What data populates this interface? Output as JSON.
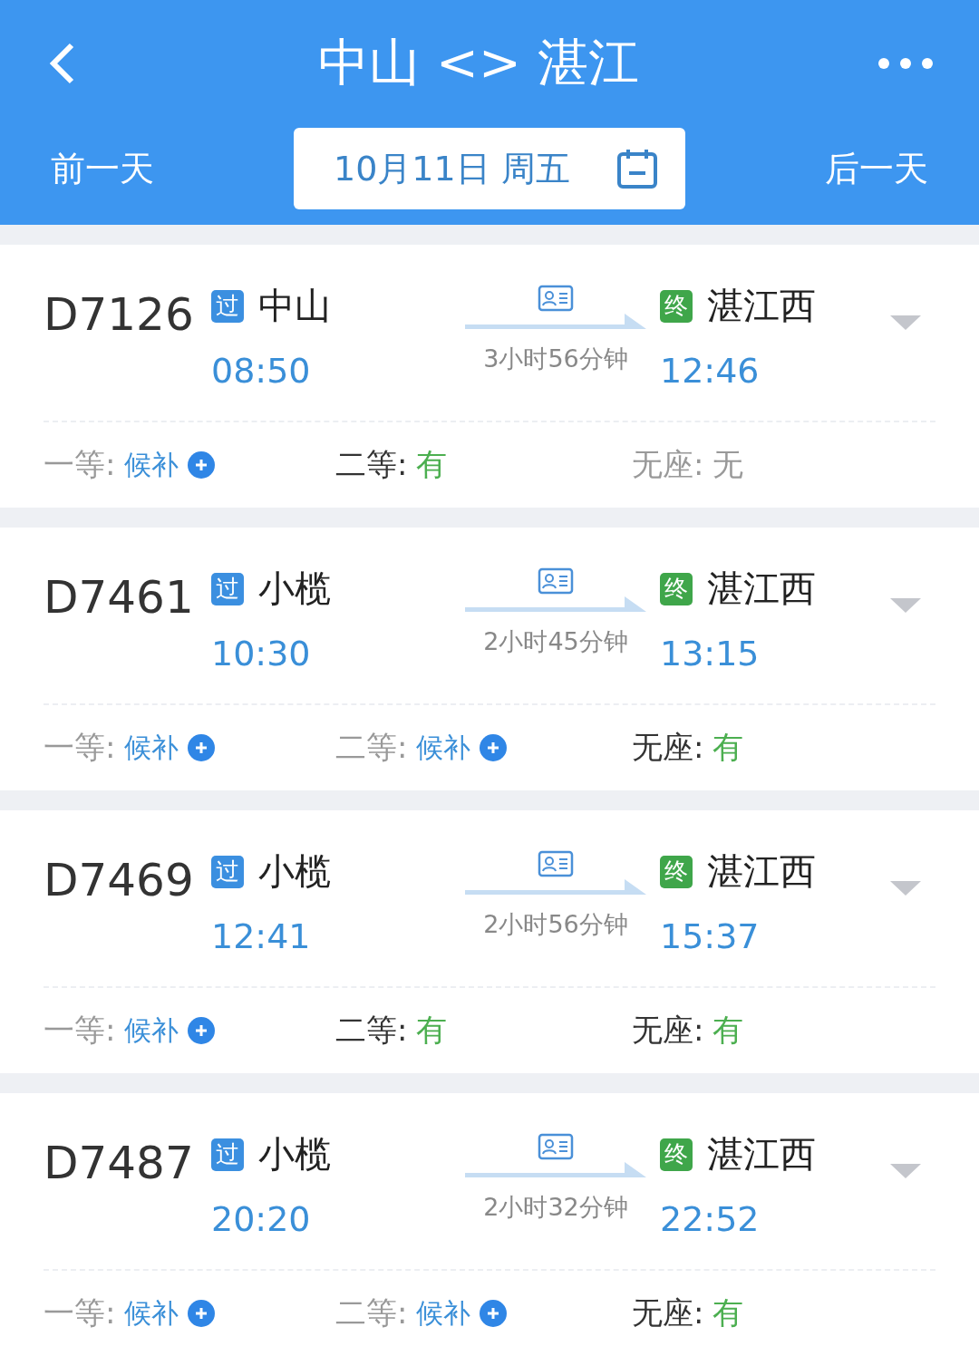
{
  "header": {
    "title": "中山 <> 湛江",
    "prev_day": "前一天",
    "date": "10月11日 周五",
    "next_day": "后一天"
  },
  "trains": [
    {
      "number": "D7126",
      "from_tag": "过",
      "from": "中山",
      "depart": "08:50",
      "duration": "3小时56分钟",
      "to_tag": "终",
      "to": "湛江西",
      "arrive": "12:46",
      "seats": [
        {
          "label": "一等:",
          "value": "候补",
          "kind": "waitlist"
        },
        {
          "label": "二等:",
          "value": "有",
          "kind": "available"
        },
        {
          "label": "无座:",
          "value": "无",
          "kind": "none"
        }
      ]
    },
    {
      "number": "D7461",
      "from_tag": "过",
      "from": "小榄",
      "depart": "10:30",
      "duration": "2小时45分钟",
      "to_tag": "终",
      "to": "湛江西",
      "arrive": "13:15",
      "seats": [
        {
          "label": "一等:",
          "value": "候补",
          "kind": "waitlist"
        },
        {
          "label": "二等:",
          "value": "候补",
          "kind": "waitlist"
        },
        {
          "label": "无座:",
          "value": "有",
          "kind": "available"
        }
      ]
    },
    {
      "number": "D7469",
      "from_tag": "过",
      "from": "小榄",
      "depart": "12:41",
      "duration": "2小时56分钟",
      "to_tag": "终",
      "to": "湛江西",
      "arrive": "15:37",
      "seats": [
        {
          "label": "一等:",
          "value": "候补",
          "kind": "waitlist"
        },
        {
          "label": "二等:",
          "value": "有",
          "kind": "available"
        },
        {
          "label": "无座:",
          "value": "有",
          "kind": "available"
        }
      ]
    },
    {
      "number": "D7487",
      "from_tag": "过",
      "from": "小榄",
      "depart": "20:20",
      "duration": "2小时32分钟",
      "to_tag": "终",
      "to": "湛江西",
      "arrive": "22:52",
      "seats": [
        {
          "label": "一等:",
          "value": "候补",
          "kind": "waitlist"
        },
        {
          "label": "二等:",
          "value": "候补",
          "kind": "waitlist"
        },
        {
          "label": "无座:",
          "value": "有",
          "kind": "available"
        }
      ]
    }
  ]
}
